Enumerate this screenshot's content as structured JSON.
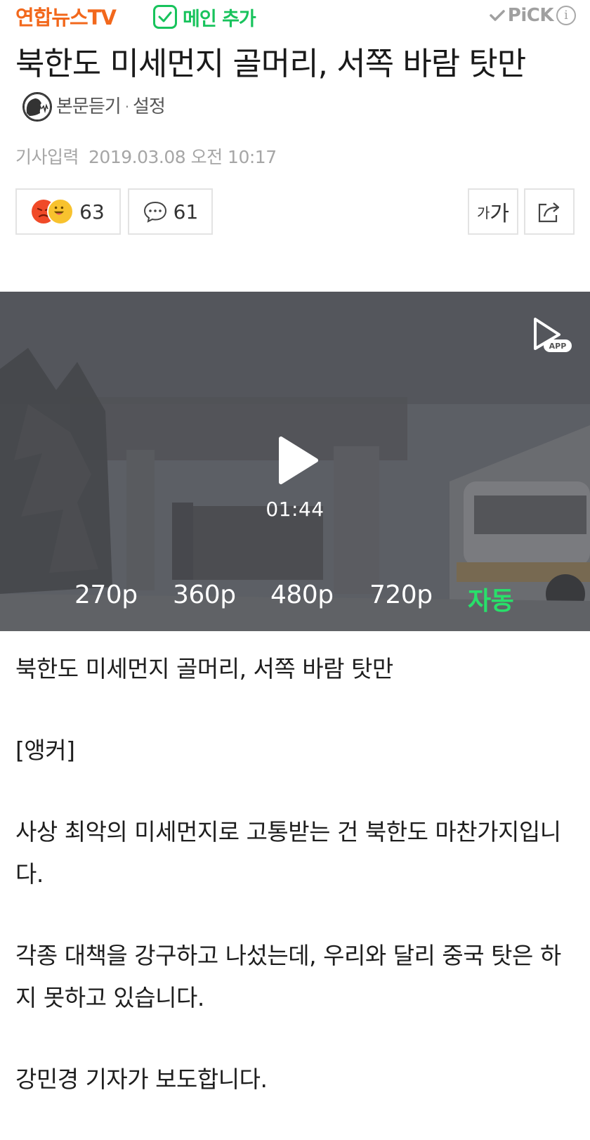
{
  "topbar": {
    "brand": "연합뉴스TV",
    "follow_label": "메인 추가",
    "pick_label": "PiCK",
    "info_icon": "i"
  },
  "article": {
    "title": "북한도 미세먼지 골머리, 서쪽 바람 탓만",
    "tts_label": "본문듣기",
    "tts_separator": "·",
    "tts_settings": "설정",
    "date_label": "기사입력",
    "date_value": "2019.03.08 오전 10:17",
    "reaction_count": "63",
    "comment_count": "61",
    "font_small": "가",
    "font_big": "가"
  },
  "video": {
    "app_badge": "APP",
    "duration": "01:44",
    "qualities": [
      "270p",
      "360p",
      "480p",
      "720p",
      "자동"
    ],
    "selected_quality": "자동",
    "accent_color": "#28e06a"
  },
  "body": {
    "paragraphs": [
      "북한도 미세먼지 골머리, 서쪽 바람 탓만",
      "[앵커]",
      "사상 최악의 미세먼지로 고통받는 건 북한도 마찬가지입니다.",
      "각종 대책을 강구하고 나섰는데, 우리와 달리 중국 탓은 하지 못하고 있습니다.",
      "강민경 기자가 보도합니다."
    ]
  },
  "colors": {
    "brand": "#f2681c",
    "follow": "#18c35c",
    "muted": "#a6a6a6"
  }
}
